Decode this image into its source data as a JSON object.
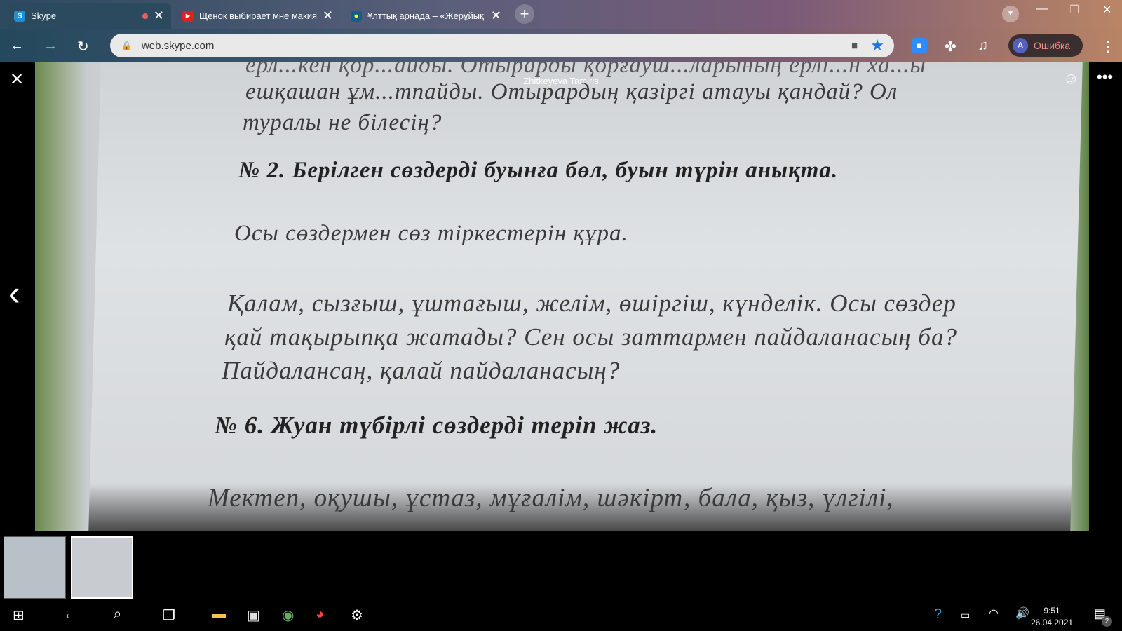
{
  "browser": {
    "tabs": [
      {
        "title": "Skype",
        "icon": "skype-icon",
        "active": true
      },
      {
        "title": "Щенок выбирает мне макияж",
        "icon": "youtube-icon"
      },
      {
        "title": "Ұлттық арнада – «Жерұйық»",
        "icon": "qazaqstan-tv-icon"
      }
    ],
    "url": "web.skype.com",
    "profile_initial": "A",
    "profile_status": "Ошибка"
  },
  "viewer": {
    "caller_name": "Zhitkeyeva Tamiris",
    "document_lines": [
      "ерл...кен қор...айды. Отырарды қорғауш...ларының ерлі...н ха...ы",
      "ешқашан ұм...тпайды. Отырардың қазіргі атауы қандай? Ол",
      "туралы не білесің?",
      "№ 2. Берілген сөздерді буынға бөл, буын түрін анықта.",
      "Осы сөздермен сөз тіркестерін құра.",
      "Қалам, сызғыш, ұштағыш, желім, өшіргіш, күнделік. Осы сөздер",
      "қай тақырыпқа жатады? Сен осы заттармен пайдаланасың ба?",
      "Пайдалансаң, қалай пайдаланасың?",
      "№ 6. Жуан түбірлі сөздерді теріп жаз.",
      "Мектеп, оқушы, ұстаз, мұғалім, шәкірт, бала, қыз, үлгілі,"
    ]
  },
  "taskbar": {
    "time": "9:51",
    "date": "26.04.2021",
    "notifications": "2"
  }
}
